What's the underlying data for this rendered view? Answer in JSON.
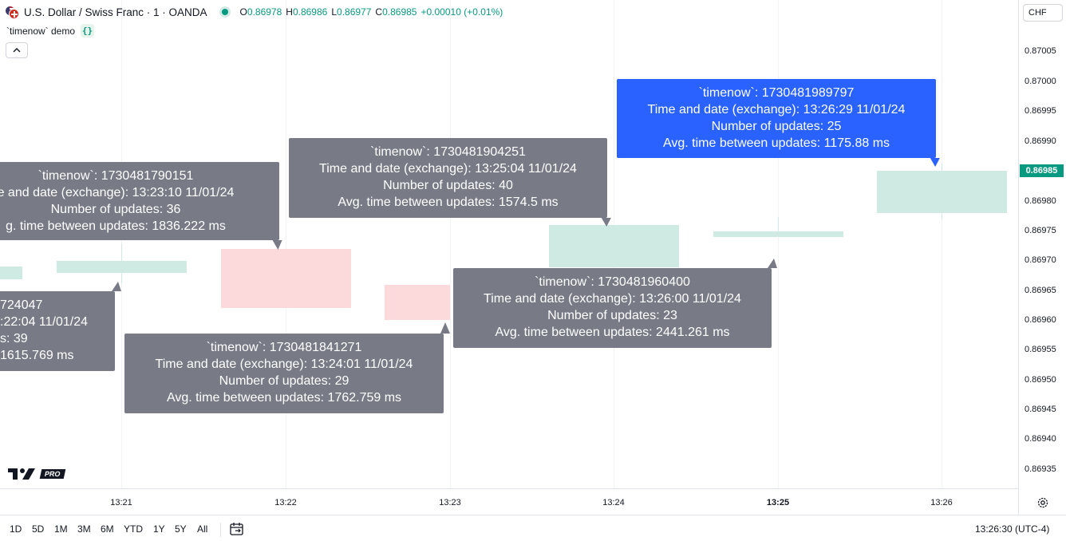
{
  "header": {
    "symbol_title": "U.S. Dollar / Swiss Franc · 1 · OANDA",
    "ohlc": {
      "o_key": "O",
      "o_val": "0.86978",
      "h_key": "H",
      "h_val": "0.86986",
      "l_key": "L",
      "l_val": "0.86977",
      "c_key": "C",
      "c_val": "0.86985",
      "change": "+0.00010 (+0.01%)"
    },
    "up_color": "#089981",
    "down_color": "#f23645"
  },
  "indicator": {
    "name": "`timenow` demo",
    "icon": "braces-icon"
  },
  "price_scale": {
    "currency": "CHF",
    "ticks": [
      "0.87005",
      "0.87000",
      "0.86995",
      "0.86990",
      "0.86980",
      "0.86975",
      "0.86970",
      "0.86965",
      "0.86960",
      "0.86955",
      "0.86950",
      "0.86945",
      "0.86940",
      "0.86935"
    ],
    "last_price": "0.86985"
  },
  "time_axis": {
    "ticks": [
      "13:21",
      "13:22",
      "13:23",
      "13:24",
      "13:25",
      "13:26"
    ]
  },
  "labels": [
    {
      "line1": "`timenow`: 1730481790151",
      "line2": "e and date (exchange): 13:23:10 11/01/24",
      "line3": "Number of updates: 36",
      "line4": "g. time between updates: 1836.222 ms"
    },
    {
      "line1": "724047",
      "line2": ":22:04 11/01/24",
      "line3": "s: 39",
      "line4": "1615.769 ms"
    },
    {
      "line1": "`timenow`: 1730481841271",
      "line2": "Time and date (exchange): 13:24:01 11/01/24",
      "line3": "Number of updates: 29",
      "line4": "Avg. time between updates: 1762.759 ms"
    },
    {
      "line1": "`timenow`: 1730481904251",
      "line2": "Time and date (exchange): 13:25:04 11/01/24",
      "line3": "Number of updates: 40",
      "line4": "Avg. time between updates: 1574.5 ms"
    },
    {
      "line1": "`timenow`: 1730481960400",
      "line2": "Time and date (exchange): 13:26:00 11/01/24",
      "line3": "Number of updates: 23",
      "line4": "Avg. time between updates: 2441.261 ms"
    },
    {
      "line1": "`timenow`: 1730481989797",
      "line2": "Time and date (exchange): 13:26:29 11/01/24",
      "line3": "Number of updates: 25",
      "line4": "Avg. time between updates: 1175.88 ms"
    }
  ],
  "bottom_bar": {
    "ranges": [
      "1D",
      "5D",
      "1M",
      "3M",
      "6M",
      "YTD",
      "1Y",
      "5Y",
      "All"
    ],
    "clock": "13:26:30 (UTC-4)"
  },
  "watermark": {
    "logo_text": "TV",
    "badge": "PRO"
  }
}
